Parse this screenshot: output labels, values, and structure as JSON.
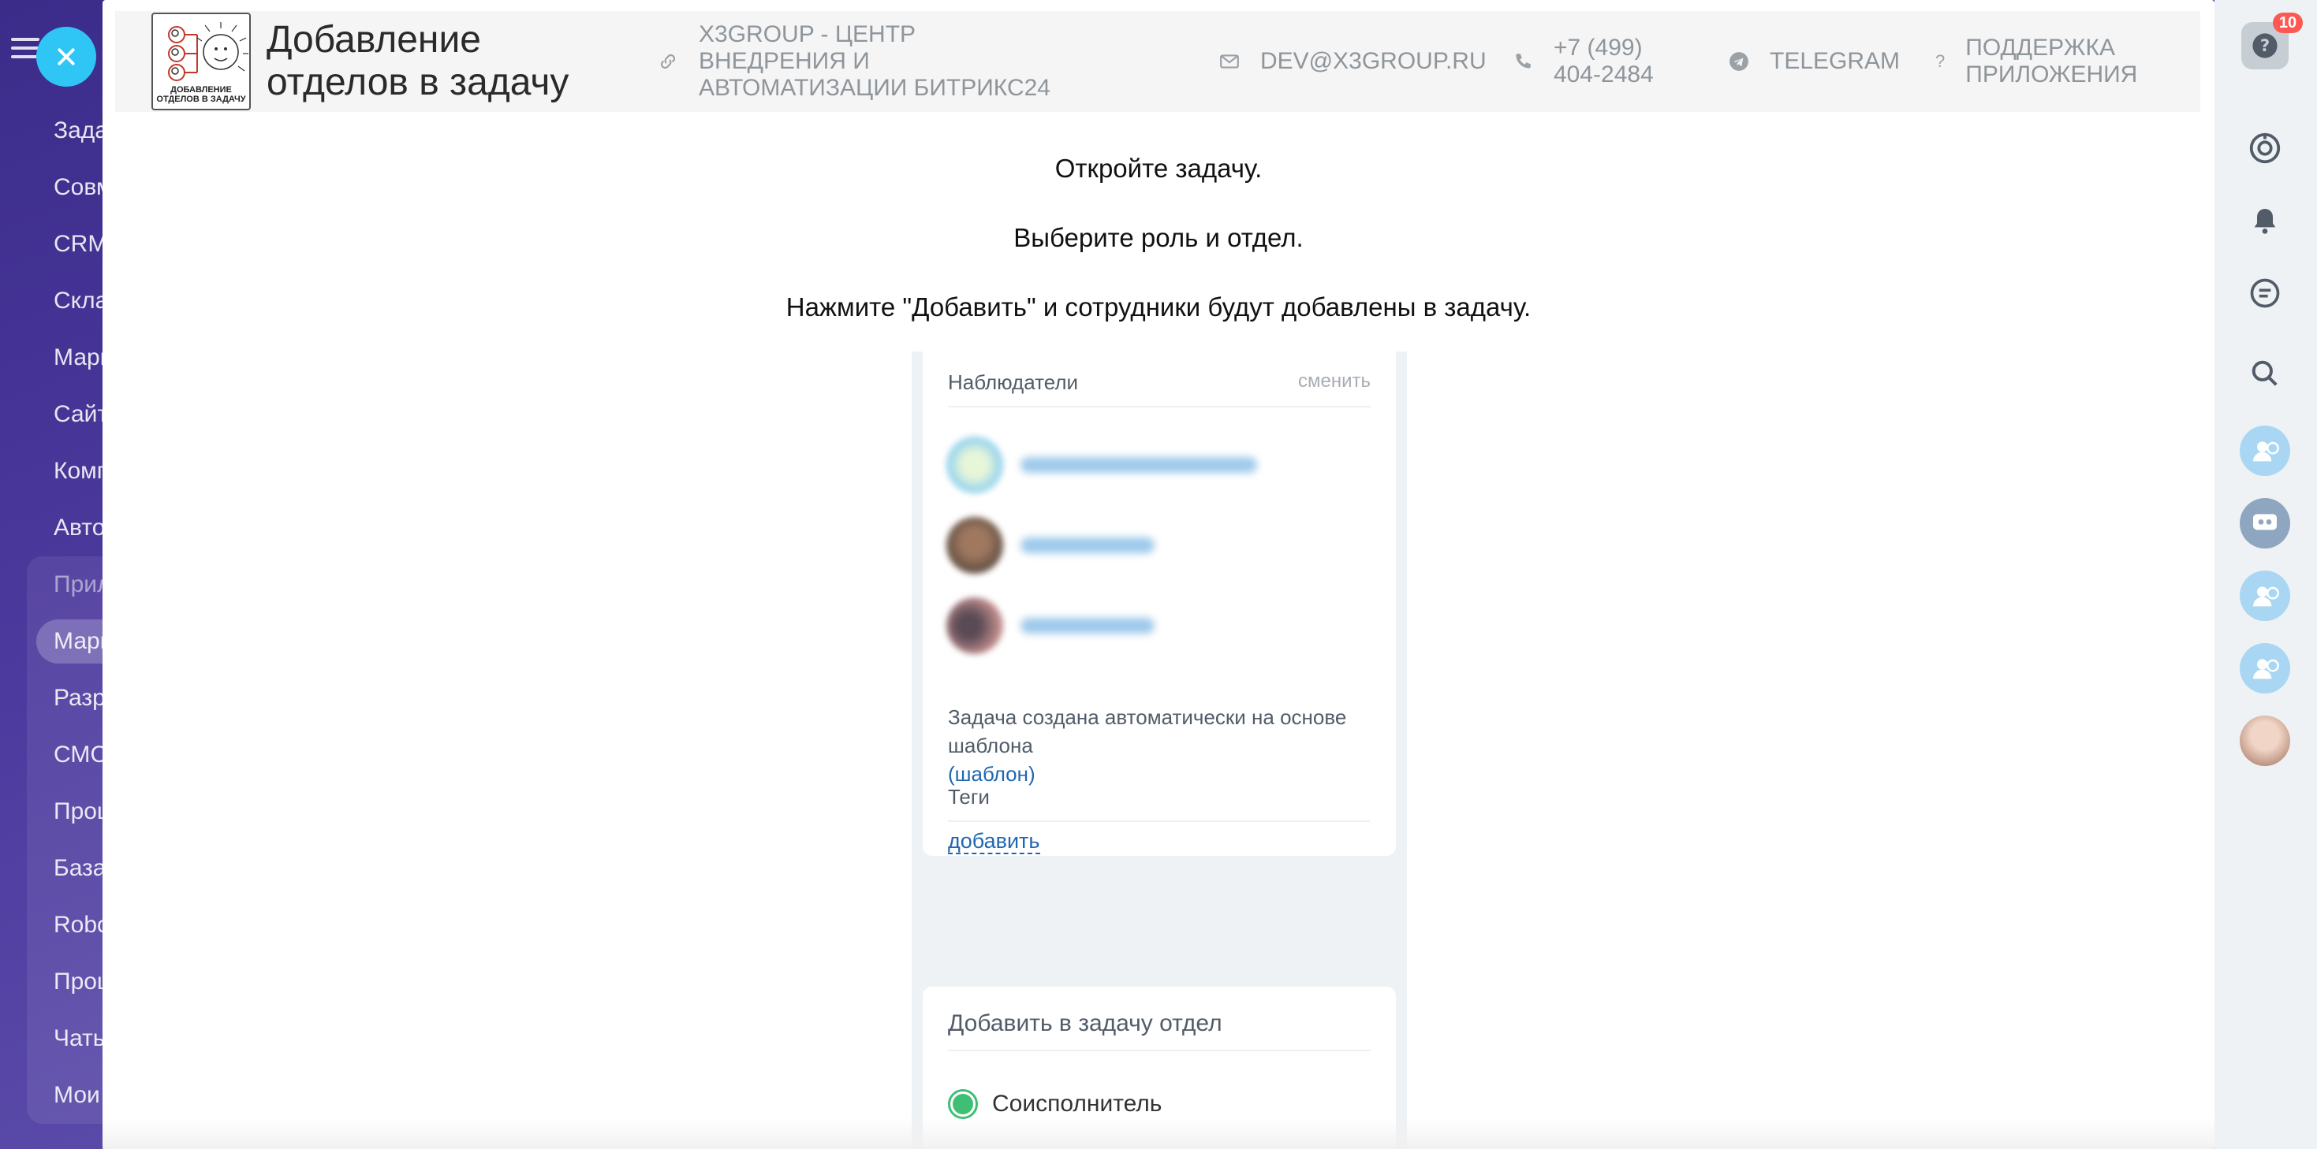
{
  "background_menu": {
    "items": [
      "Задачи и проекты",
      "Совместная работа",
      "CRM",
      "Склад",
      "Маркетинг",
      "Сайты и магазины",
      "Компания",
      "Автоматизация"
    ],
    "group_items": [
      "Приложения",
      "Маркет",
      "Разработчикам",
      "СМС-провайдеры",
      "Процессы",
      "База знаний",
      "Robots",
      "Процессы",
      "Чаты",
      "Мои"
    ],
    "active_group_item": "Маркет"
  },
  "right_panel": {
    "help_badge": "10"
  },
  "header": {
    "logo_caption": "ДОБАВЛЕНИЕ ОТДЕЛОВ В ЗАДАЧУ",
    "title": "Добавление отделов в задачу",
    "company_link": "X3GROUP - ЦЕНТР ВНЕДРЕНИЯ И АВТОМАТИЗАЦИИ БИТРИКС24",
    "email": "DEV@X3GROUP.RU",
    "phone": "+7 (499) 404-2484",
    "telegram": "TELEGRAM",
    "support": "ПОДДЕРЖКА ПРИЛОЖЕНИЯ"
  },
  "instructions": [
    "Откройте задачу.",
    "Выберите роль и отдел.",
    "Нажмите \"Добавить\" и сотрудники будут добавлены в задачу."
  ],
  "screenshot": {
    "observers_label": "Наблюдатели",
    "change_label": "сменить",
    "note_text": "Задача создана автоматически на основе шаблона",
    "template_link": "(шаблон)",
    "tags_label": "Теги",
    "add_link": "добавить",
    "dept_card_title": "Добавить в задачу отдел",
    "role_option": "Соисполнитель"
  },
  "colors": {
    "accent": "#2fc6f6",
    "link": "#2067b0",
    "radio": "#3fbf74",
    "badge": "#ff5752"
  }
}
